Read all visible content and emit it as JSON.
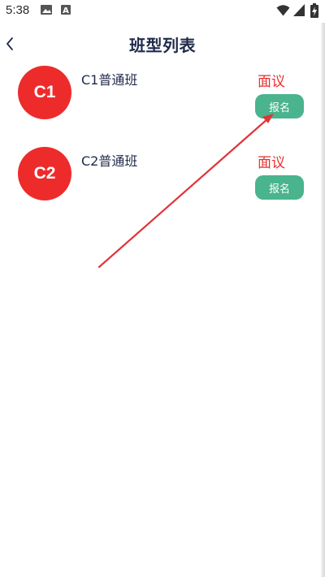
{
  "status_bar": {
    "time": "5:38",
    "icons": [
      "gallery-icon",
      "a-letter-icon",
      "wifi-icon",
      "signal-icon",
      "battery-charging-icon"
    ]
  },
  "header": {
    "title": "班型列表",
    "back_icon": "chevron-left-icon"
  },
  "classes": [
    {
      "avatar_text": "C1",
      "name": "C1普通班",
      "price": "面议",
      "enroll_label": "报名"
    },
    {
      "avatar_text": "C2",
      "name": "C2普通班",
      "price": "面议",
      "enroll_label": "报名"
    }
  ],
  "colors": {
    "avatar": "#ee2b2b",
    "price": "#e8302f",
    "enroll_button": "#49b48e",
    "title": "#1f2a4a",
    "annotation_arrow": "#e0353b"
  }
}
